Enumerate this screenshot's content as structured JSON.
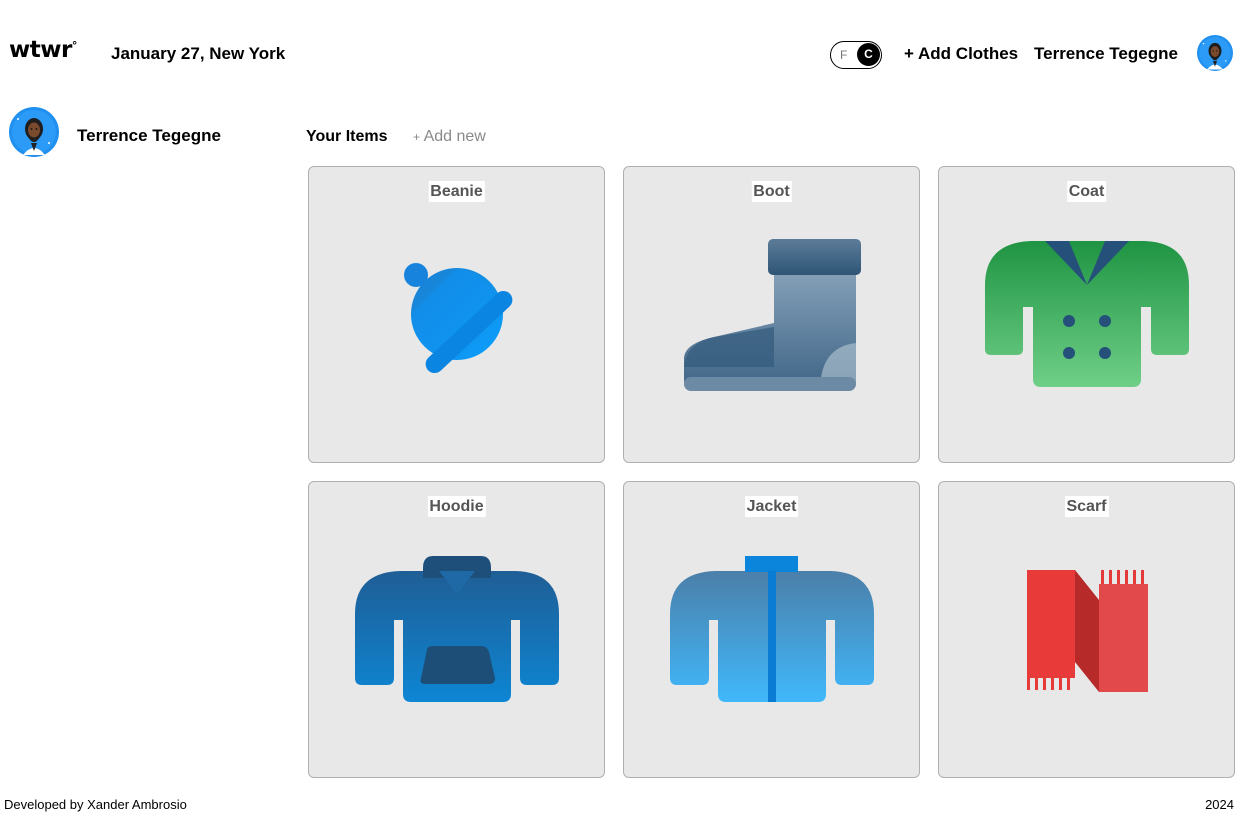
{
  "header": {
    "logo": "wtwr",
    "logo_mark": "°",
    "date_location": "January 27, New York",
    "toggle": {
      "off_label": "F",
      "on_label": "C",
      "selected": "C"
    },
    "add_clothes": "+ Add Clothes",
    "user_name": "Terrence Tegegne"
  },
  "sidebar": {
    "user_name": "Terrence Tegegne"
  },
  "items_section": {
    "title": "Your Items",
    "add_new_plus": "+",
    "add_new_label": " Add new",
    "items": [
      {
        "name": "Beanie",
        "icon": "beanie-icon"
      },
      {
        "name": "Boot",
        "icon": "boot-icon"
      },
      {
        "name": "Coat",
        "icon": "coat-icon"
      },
      {
        "name": "Hoodie",
        "icon": "hoodie-icon"
      },
      {
        "name": "Jacket",
        "icon": "jacket-icon"
      },
      {
        "name": "Scarf",
        "icon": "scarf-icon"
      }
    ]
  },
  "footer": {
    "credit": "Developed by Xander Ambrosio",
    "year": "2024"
  },
  "colors": {
    "card_bg": "#e8e8e8",
    "beanie": "#0a8fe8",
    "boot": "#3f6688",
    "coat": "#37a853",
    "hoodie": "#1a6fb0",
    "jacket": "#3aa8ec",
    "scarf": "#e8403d"
  }
}
